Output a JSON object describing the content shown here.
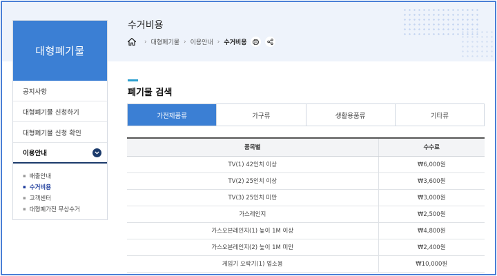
{
  "header": {
    "title": "수거비용",
    "breadcrumb": [
      "대형폐기물",
      "이용안내",
      "수거비용"
    ]
  },
  "sidebar": {
    "heading": "대형폐기물",
    "items": [
      {
        "label": "공지사항"
      },
      {
        "label": "대형폐기물 신청하기"
      },
      {
        "label": "대형폐기물 신청 확인"
      },
      {
        "label": "이용안내"
      }
    ],
    "sub_items": [
      {
        "label": "배출안내"
      },
      {
        "label": "수거비용"
      },
      {
        "label": "고객센터"
      },
      {
        "label": "대형폐가전 무상수거"
      }
    ]
  },
  "main": {
    "section_title": "폐기물 검색",
    "tabs": [
      {
        "label": "가전제품류"
      },
      {
        "label": "가구류"
      },
      {
        "label": "생활용품류"
      },
      {
        "label": "기타류"
      }
    ],
    "table": {
      "headers": [
        "품목별",
        "수수료"
      ],
      "rows": [
        [
          "TV(1) 42인치 이상",
          "₩6,000원"
        ],
        [
          "TV(2) 25인치 이상",
          "₩3,600원"
        ],
        [
          "TV(3) 25인치 미만",
          "₩3,000원"
        ],
        [
          "가스레인지",
          "₩2,500원"
        ],
        [
          "가스오븐레인지(1) 높이 1M 이상",
          "₩4,800원"
        ],
        [
          "가스오븐레인지(2) 높이 1M 미만",
          "₩2,400원"
        ],
        [
          "게임기 오락기(1) 업소용",
          "₩10,000원"
        ]
      ]
    }
  },
  "icons": {
    "home": "home-icon",
    "print": "print-icon",
    "share": "share-icon",
    "chevron": "chevron-down-icon"
  },
  "colors": {
    "brand_blue": "#3b7fd4",
    "navy": "#1b3a6b",
    "header_bg": "#eef3fb",
    "frame_border": "#4a7fd6"
  }
}
